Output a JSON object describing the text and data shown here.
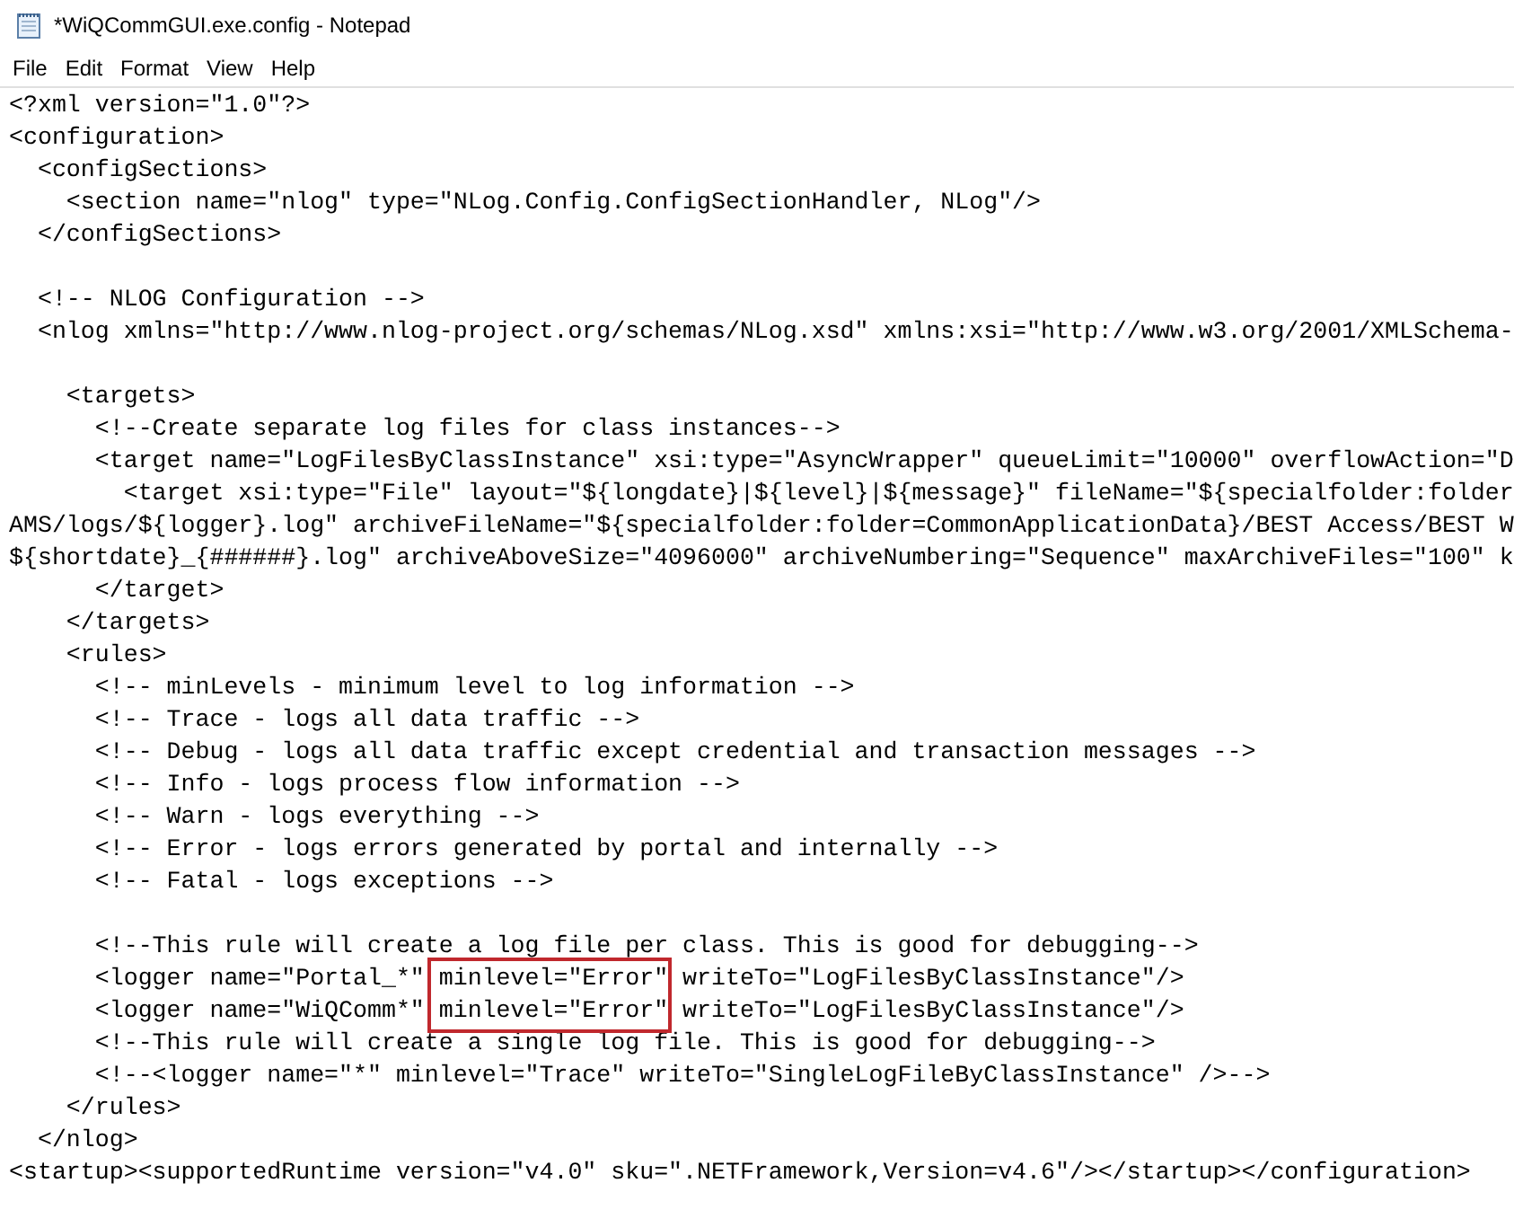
{
  "window": {
    "title": "*WiQCommGUI.exe.config - Notepad"
  },
  "menu": [
    "File",
    "Edit",
    "Format",
    "View",
    "Help"
  ],
  "lines": [
    {
      "text": "<?xml version=\"1.0\"?>"
    },
    {
      "text": "<configuration>"
    },
    {
      "text": "  <configSections>"
    },
    {
      "text": "    <section name=\"nlog\" type=\"NLog.Config.ConfigSectionHandler, NLog\"/>"
    },
    {
      "text": "  </configSections>"
    },
    {
      "text": "  <!-- NLOG Configuration -->",
      "blank_line_before": true
    },
    {
      "text": "  <nlog xmlns=\"http://www.nlog-project.org/schemas/NLog.xsd\" xmlns:xsi=\"http://www.w3.org/2001/XMLSchema-"
    },
    {
      "text": "    <targets>",
      "blank_line_before": true
    },
    {
      "text": "      <!--Create separate log files for class instances-->"
    },
    {
      "text": "      <target name=\"LogFilesByClassInstance\" xsi:type=\"AsyncWrapper\" queueLimit=\"10000\" overflowAction=\"D"
    },
    {
      "text": "        <target xsi:type=\"File\" layout=\"${longdate}|${level}|${message}\" fileName=\"${specialfolder:folder"
    },
    {
      "text": "AMS/logs/${logger}.log\" archiveFileName=\"${specialfolder:folder=CommonApplicationData}/BEST Access/BEST W"
    },
    {
      "text": "${shortdate}_{######}.log\" archiveAboveSize=\"4096000\" archiveNumbering=\"Sequence\" maxArchiveFiles=\"100\" k"
    },
    {
      "text": "      </target>"
    },
    {
      "text": "    </targets>"
    },
    {
      "text": "    <rules>"
    },
    {
      "text": "      <!-- minLevels - minimum level to log information -->"
    },
    {
      "text": "      <!-- Trace - logs all data traffic -->"
    },
    {
      "text": "      <!-- Debug - logs all data traffic except credential and transaction messages -->"
    },
    {
      "text": "      <!-- Info - logs process flow information -->"
    },
    {
      "text": "      <!-- Warn - logs everything -->"
    },
    {
      "text": "      <!-- Error - logs errors generated by portal and internally -->"
    },
    {
      "text": "      <!-- Fatal - logs exceptions -->"
    },
    {
      "text": "      <!--This rule will create a log file per class. This is good for debugging-->",
      "blank_line_before": true
    },
    {
      "text": "      <logger name=\"Portal_*\" minlevel=\"Error\" writeTo=\"LogFilesByClassInstance\"/>",
      "highlighted": true
    },
    {
      "text": "      <logger name=\"WiQComm*\" minlevel=\"Error\" writeTo=\"LogFilesByClassInstance\"/>",
      "highlighted": true
    },
    {
      "text": "      <!--This rule will create a single log file. This is good for debugging-->"
    },
    {
      "text": "      <!--<logger name=\"*\" minlevel=\"Trace\" writeTo=\"SingleLogFileByClassInstance\" />-->"
    },
    {
      "text": "    </rules>"
    },
    {
      "text": "  </nlog>"
    },
    {
      "text": "<startup><supportedRuntime version=\"v4.0\" sku=\".NETFramework,Version=v4.6\"/></startup></configuration>"
    }
  ]
}
